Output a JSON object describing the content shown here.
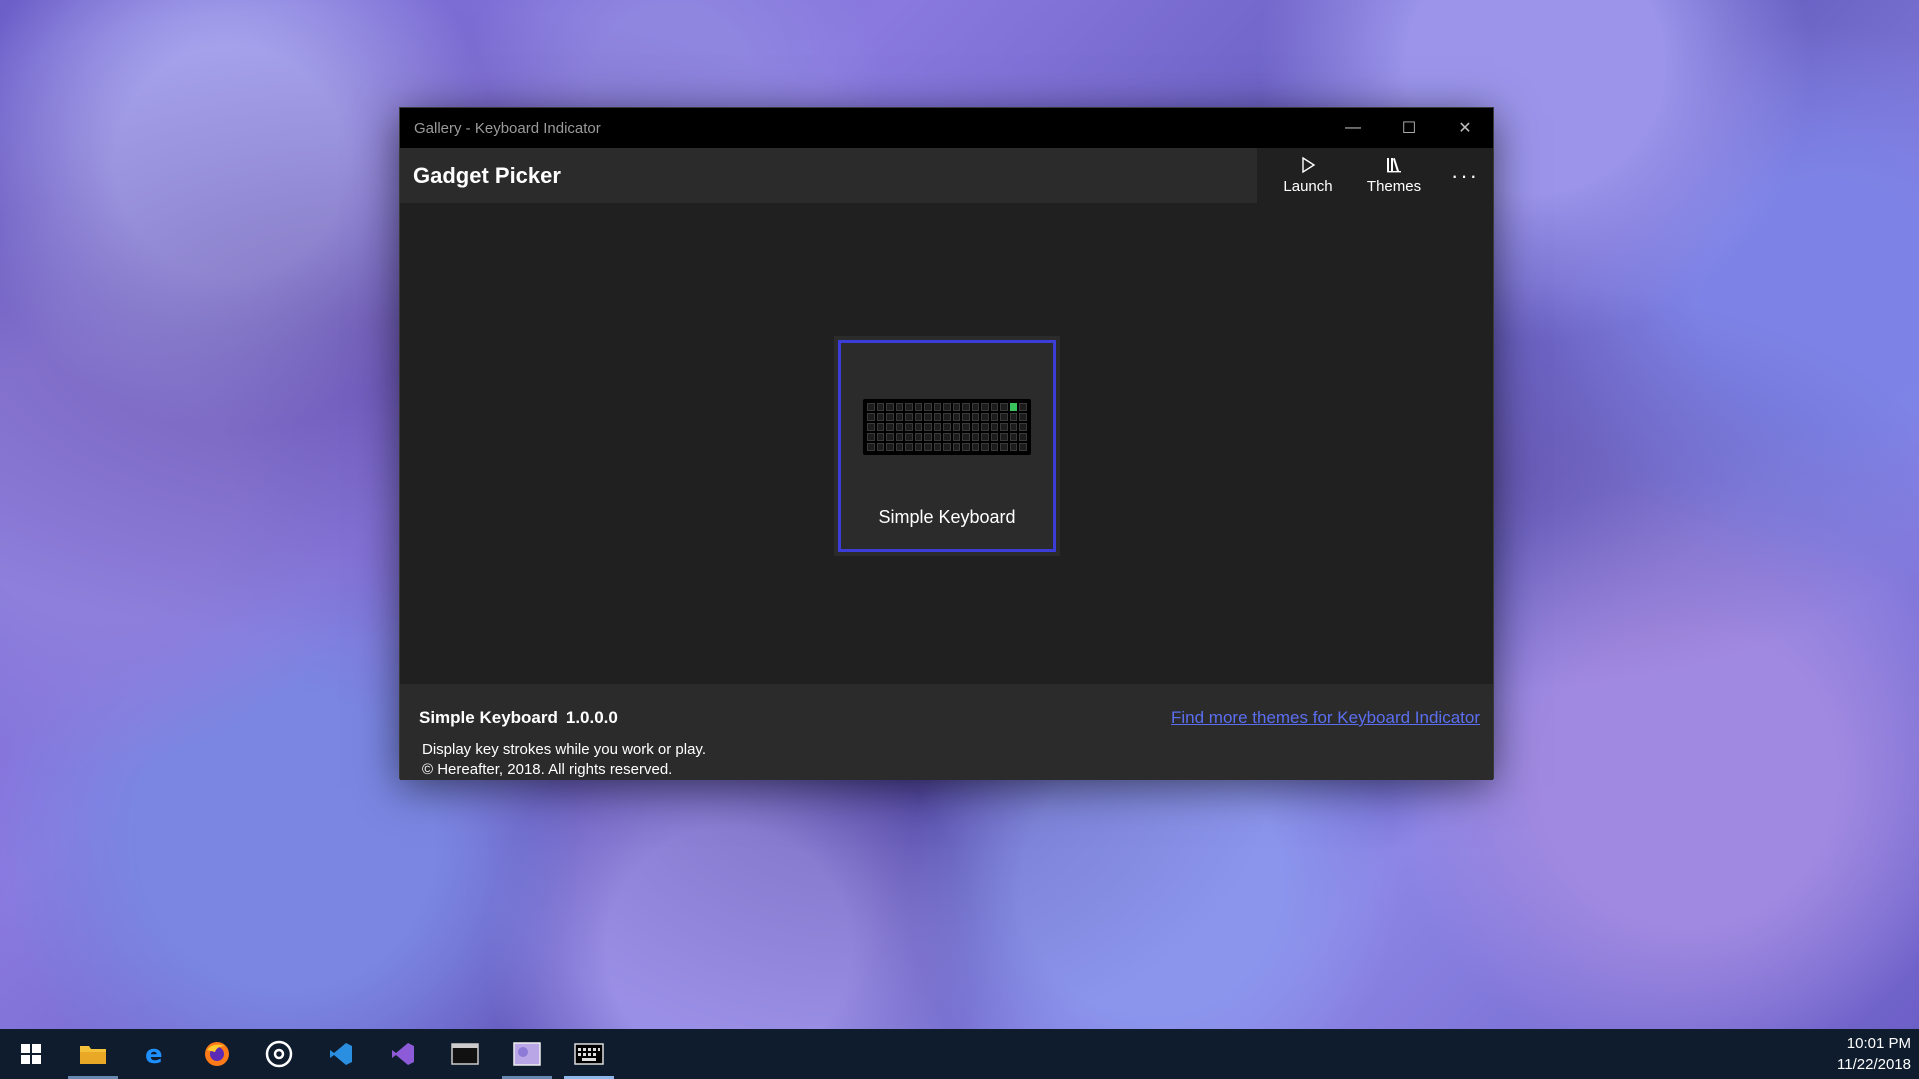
{
  "window": {
    "title": "Gallery - Keyboard Indicator",
    "minimize": "—",
    "maximize": "☐",
    "close": "✕"
  },
  "appbar": {
    "header": "Gadget Picker",
    "launch_label": "Launch",
    "themes_label": "Themes",
    "more_label": "···"
  },
  "tile": {
    "label": "Simple Keyboard",
    "selection_color": "#3c3cd6"
  },
  "info": {
    "name": "Simple Keyboard",
    "version": "1.0.0.0",
    "description": "Display key strokes while you work or play.",
    "copyright": "© Hereafter, 2018. All rights reserved.",
    "link": "Find more themes for Keyboard Indicator"
  },
  "taskbar": {
    "items": [
      {
        "name": "start-icon"
      },
      {
        "name": "file-explorer-icon"
      },
      {
        "name": "edge-icon"
      },
      {
        "name": "firefox-icon"
      },
      {
        "name": "groove-icon"
      },
      {
        "name": "vscode-icon"
      },
      {
        "name": "visual-studio-icon"
      },
      {
        "name": "terminal-icon"
      },
      {
        "name": "photos-icon"
      },
      {
        "name": "keyboard-indicator-icon"
      }
    ],
    "time": "10:01 PM",
    "date": "11/22/2018"
  }
}
